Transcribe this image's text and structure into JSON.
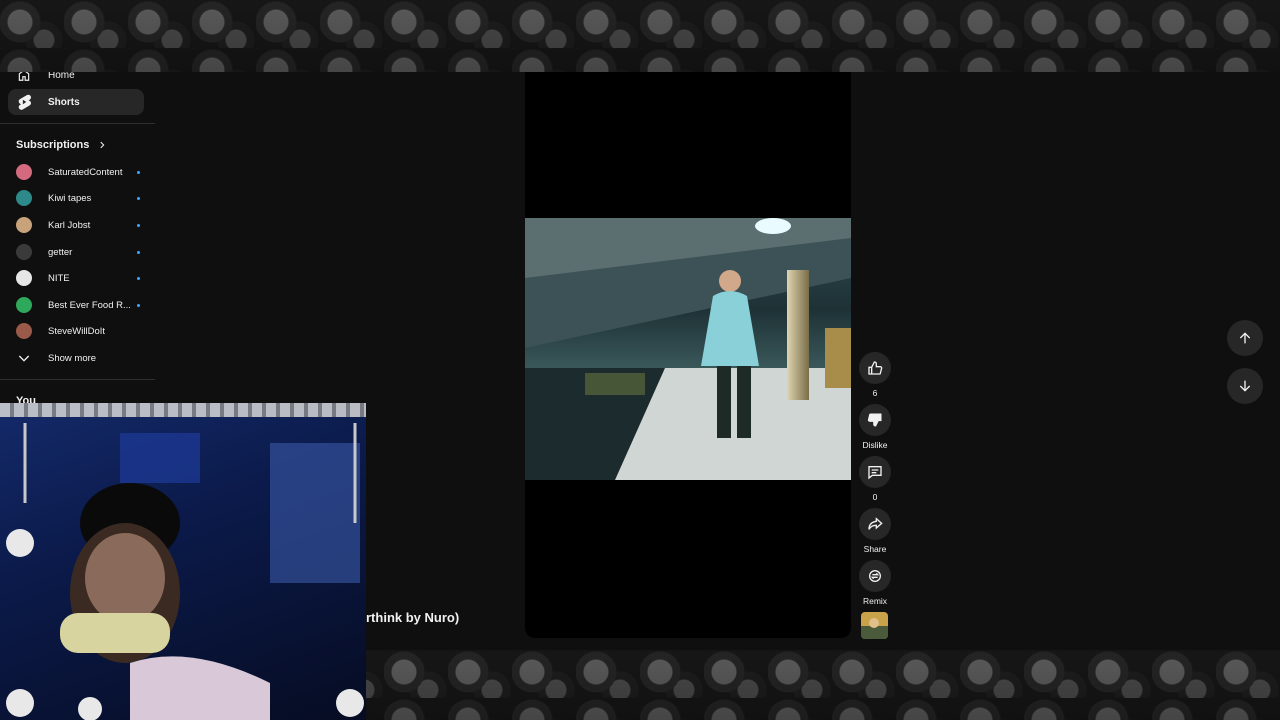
{
  "sidebar": {
    "nav": [
      {
        "label": "Home",
        "icon": "home-icon"
      },
      {
        "label": "Shorts",
        "icon": "shorts-icon"
      }
    ],
    "subscriptions_title": "Subscriptions",
    "subscriptions": [
      {
        "name": "SaturatedContent",
        "color": "#d46a7e"
      },
      {
        "name": "Kiwi tapes",
        "color": "#2e8a8a"
      },
      {
        "name": "Karl Jobst",
        "color": "#c7a27a"
      },
      {
        "name": "getter",
        "color": "#3a3a3a"
      },
      {
        "name": "NITE",
        "color": "#e6e6e6"
      },
      {
        "name": "Best Ever Food R...",
        "color": "#2ea85a"
      },
      {
        "name": "SteveWillDoIt",
        "color": "#9a5a4a"
      }
    ],
    "show_more": "Show more",
    "you_title": "You"
  },
  "actions": {
    "like_count": "6",
    "dislike_label": "Dislike",
    "comment_count": "0",
    "share_label": "Share",
    "remix_label": "Remix"
  },
  "title_fragment": "rthink by Nuro)",
  "colors": {
    "accent": "#3ea6ff",
    "button_bg": "#272727",
    "page_bg": "#0f0f0f"
  }
}
